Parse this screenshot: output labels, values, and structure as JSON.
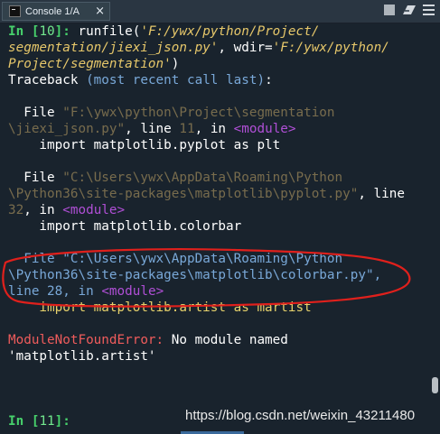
{
  "tab": {
    "label": "Console 1/A",
    "close": "×"
  },
  "lines": {
    "l1": {
      "prompt": "In [",
      "num": "10",
      "prompt_end": "]:",
      "code": " runfile(",
      "str": "'F:/ywx/python/Project/"
    },
    "l2": {
      "str": "segmentation/jiexi_json.py'",
      "code": ", wdir=",
      "str2": "'F:/ywx/python/"
    },
    "l3": {
      "str": "Project/segmentation'",
      "code": ")"
    },
    "l4": {
      "a": "Traceback ",
      "b": "(most recent call last)",
      "c": ":"
    },
    "l6": {
      "a": "  File ",
      "b": "\"F:\\ywx\\python\\Project\\segmentation"
    },
    "l7": {
      "a": "\\jiexi_json.py\"",
      "b": ", line ",
      "c": "11",
      "d": ", in ",
      "e": "<module>"
    },
    "l8": {
      "a": "    import matplotlib.pyplot as plt"
    },
    "l10": {
      "a": "  File ",
      "b": "\"C:\\Users\\ywx\\AppData\\Roaming\\Python"
    },
    "l11": {
      "a": "\\Python36\\site-packages\\matplotlib\\pyplot.py\"",
      "b": ", line"
    },
    "l12": {
      "a": "32",
      "b": ", in ",
      "c": "<module>"
    },
    "l13": {
      "a": "    import matplotlib.colorbar"
    },
    "l15": {
      "a": "  File ",
      "b": "\"C:\\Users\\ywx\\AppData\\Roaming\\Python"
    },
    "l16": {
      "a": "\\Python36\\site-packages\\matplotlib\\colorbar.py\"",
      "b": ","
    },
    "l17": {
      "a": "line ",
      "b": "28",
      "c": ", in ",
      "d": "<module>"
    },
    "l18": {
      "a": "    import matplotlib.artist as martist"
    },
    "l20": {
      "a": "ModuleNotFoundError:",
      "b": " No module named"
    },
    "l21": {
      "a": "'matplotlib.artist'"
    },
    "l25": {
      "prompt": "In [",
      "num": "11",
      "prompt_end": "]:"
    }
  },
  "watermark": "https://blog.csdn.net/weixin_43211480",
  "colors": {
    "background": "#19232d",
    "annotation": "#e0201c"
  }
}
